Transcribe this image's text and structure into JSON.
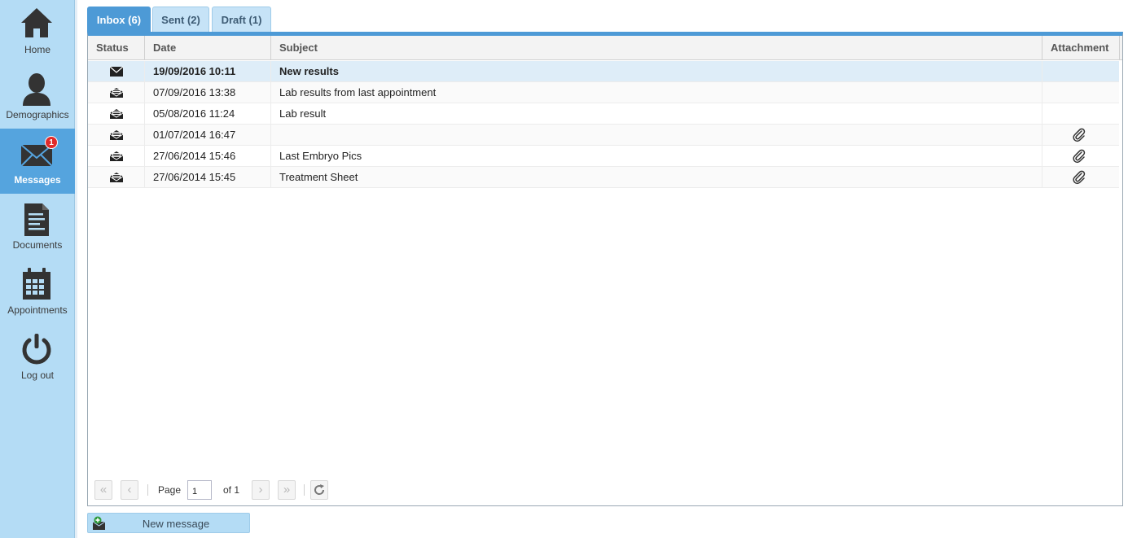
{
  "sidebar": {
    "items": [
      {
        "label": "Home",
        "icon": "home-icon"
      },
      {
        "label": "Demographics",
        "icon": "person-icon"
      },
      {
        "label": "Messages",
        "icon": "envelope-icon",
        "badge": "1",
        "active": true
      },
      {
        "label": "Documents",
        "icon": "document-icon"
      },
      {
        "label": "Appointments",
        "icon": "calendar-icon"
      },
      {
        "label": "Log out",
        "icon": "power-icon"
      }
    ]
  },
  "tabs": [
    {
      "label": "Inbox (6)",
      "active": true
    },
    {
      "label": "Sent (2)"
    },
    {
      "label": "Draft (1)"
    }
  ],
  "grid": {
    "columns": [
      "Status",
      "Date",
      "Subject",
      "Attachment"
    ],
    "rows": [
      {
        "status": "unread-envelope-icon",
        "date": "19/09/2016 10:11",
        "subject": "New results",
        "attachment": false,
        "unread": true
      },
      {
        "status": "read-envelope-icon",
        "date": "07/09/2016 13:38",
        "subject": "Lab results from last appointment",
        "attachment": false
      },
      {
        "status": "read-envelope-icon",
        "date": "05/08/2016 11:24",
        "subject": "Lab result",
        "attachment": false
      },
      {
        "status": "read-envelope-icon",
        "date": "01/07/2014 16:47",
        "subject": "",
        "attachment": true
      },
      {
        "status": "read-envelope-icon",
        "date": "27/06/2014 15:46",
        "subject": "Last Embryo Pics",
        "attachment": true
      },
      {
        "status": "read-envelope-icon",
        "date": "27/06/2014 15:45",
        "subject": "Treatment Sheet",
        "attachment": true
      }
    ]
  },
  "pager": {
    "page_label": "Page",
    "page_value": "1",
    "of_label": "of 1"
  },
  "actions": {
    "new_message_label": "New message"
  },
  "colors": {
    "sidebar_bg": "#b4dcf5",
    "accent": "#4d9ad6",
    "badge": "#e02a2a"
  }
}
